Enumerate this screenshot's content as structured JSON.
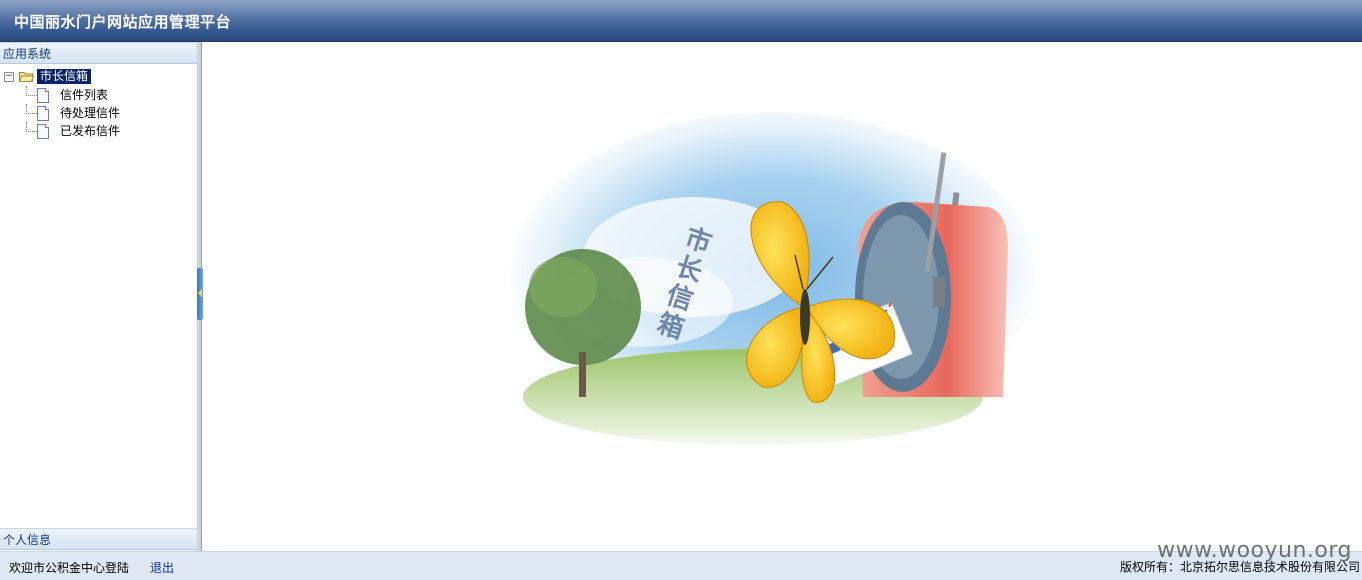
{
  "header": {
    "title": "中国丽水门户网站应用管理平台"
  },
  "sidebar": {
    "section_title": "应用系统",
    "tree": {
      "expander": "−",
      "root_label": "市长信箱",
      "children": [
        {
          "label": "信件列表"
        },
        {
          "label": "待处理信件"
        },
        {
          "label": "已发布信件"
        }
      ]
    },
    "bottom_section_title": "个人信息"
  },
  "main": {
    "hero_text": "市长信箱"
  },
  "footer": {
    "welcome": "欢迎市公积金中心登陆",
    "logout": "退出",
    "copyright": "版权所有：北京拓尔思信息技术股份有限公司"
  },
  "watermark": "www.wooyun.org",
  "colors": {
    "header": "#34588f",
    "footer": "#dfe9f5",
    "selection": "#0a246a",
    "link": "#0b2ea8"
  }
}
